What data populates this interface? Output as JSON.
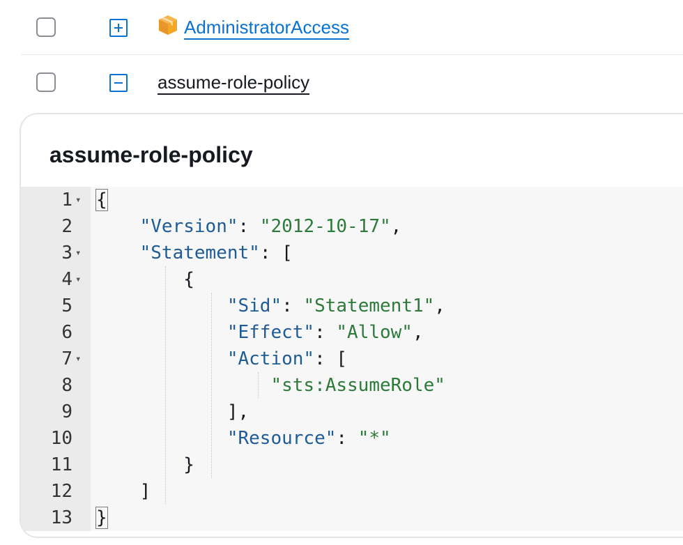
{
  "policies": [
    {
      "name": "AdministratorAccess",
      "expanded": false,
      "icon": "aws-managed-policy-icon"
    },
    {
      "name": "assume-role-policy",
      "expanded": true
    }
  ],
  "panel": {
    "title": "assume-role-policy"
  },
  "editor": {
    "lines": [
      {
        "n": "1",
        "fold": true
      },
      {
        "n": "2",
        "fold": false
      },
      {
        "n": "3",
        "fold": true
      },
      {
        "n": "4",
        "fold": true
      },
      {
        "n": "5",
        "fold": false
      },
      {
        "n": "6",
        "fold": false
      },
      {
        "n": "7",
        "fold": true
      },
      {
        "n": "8",
        "fold": false
      },
      {
        "n": "9",
        "fold": false
      },
      {
        "n": "10",
        "fold": false
      },
      {
        "n": "11",
        "fold": false
      },
      {
        "n": "12",
        "fold": false
      },
      {
        "n": "13",
        "fold": false
      }
    ],
    "keys": {
      "version": "\"Version\"",
      "statement": "\"Statement\"",
      "sid": "\"Sid\"",
      "effect": "\"Effect\"",
      "action": "\"Action\"",
      "resource": "\"Resource\""
    },
    "values": {
      "version": "\"2012-10-17\"",
      "sid": "\"Statement1\"",
      "effect": "\"Allow\"",
      "action": "\"sts:AssumeRole\"",
      "resource": "\"*\""
    }
  },
  "colors": {
    "link": "#0972d3",
    "json_key": "#1f5b96",
    "json_string": "#2c7a3a"
  }
}
